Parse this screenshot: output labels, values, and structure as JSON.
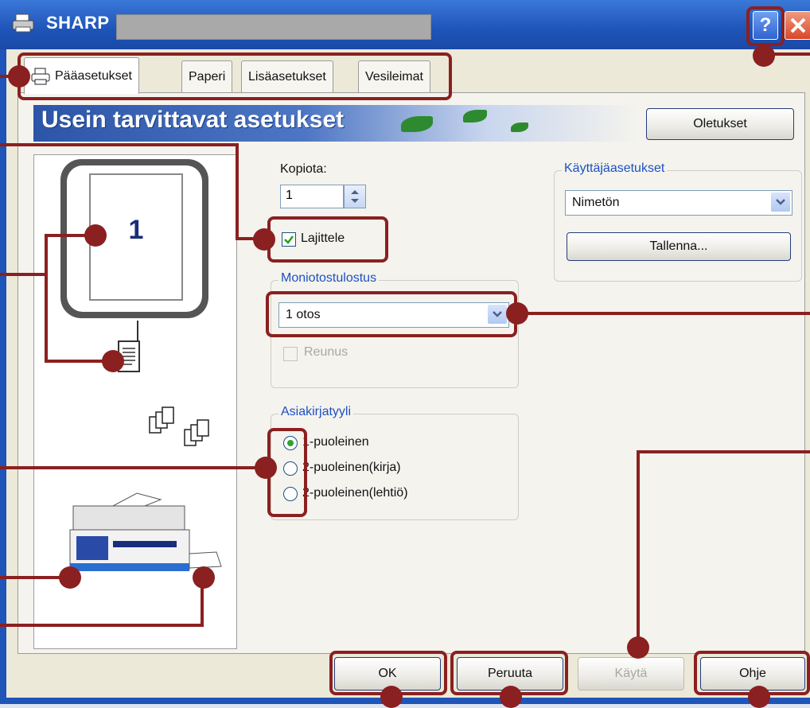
{
  "window": {
    "title": "SHARP"
  },
  "tabs": [
    {
      "label": "Pääasetukset",
      "active": true
    },
    {
      "label": "Paperi"
    },
    {
      "label": "Lisäasetukset"
    },
    {
      "label": "Vesileimat"
    }
  ],
  "banner": {
    "title": "Usein tarvittavat asetukset"
  },
  "buttons": {
    "defaults": "Oletukset",
    "save": "Tallenna...",
    "ok": "OK",
    "cancel": "Peruuta",
    "apply": "Käytä",
    "help": "Ohje",
    "title_help": "?"
  },
  "copies": {
    "label": "Kopiota:",
    "value": "1"
  },
  "collate": {
    "label": "Lajittele",
    "checked": true
  },
  "user_settings": {
    "group_label": "Käyttäjäasetukset",
    "selected": "Nimetön"
  },
  "nup": {
    "group_label": "Moniotostulostus",
    "selected": "1 otos",
    "border_label": "Reunus",
    "border_checked": false
  },
  "document_style": {
    "group_label": "Asiakirjatyyli",
    "options": [
      {
        "label": "1-puoleinen",
        "selected": true
      },
      {
        "label": "2-puoleinen(kirja)",
        "selected": false
      },
      {
        "label": "2-puoleinen(lehtiö)",
        "selected": false
      }
    ]
  },
  "preview": {
    "page_number": "1"
  },
  "colors": {
    "title_bar": "#1f54b8",
    "annotation": "#8b2020",
    "group_label": "#1c51c4"
  }
}
